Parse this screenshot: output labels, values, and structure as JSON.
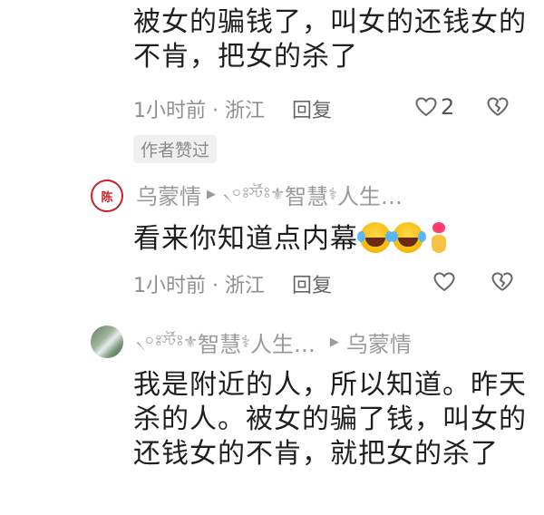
{
  "comment1": {
    "text": "被女的骗钱了，叫女的还钱女的不肯，把女的杀了",
    "time_location": "1小时前 · 浙江",
    "reply": "回复",
    "likes": "2",
    "author_badge": "作者赞过"
  },
  "reply1": {
    "avatar_char": "陈",
    "user": "乌蒙情",
    "reply_to_prefix": "৲০ঃৰ্স্টঃ",
    "reply_to_name": "智慧",
    "reply_to_suffix": "人生…",
    "text": "看来你知道点内幕",
    "time_location": "1小时前 · 浙江",
    "reply": "回复"
  },
  "reply2": {
    "user_prefix": "৲০ঃৰ্স্টঃ",
    "user_name": "智慧",
    "user_suffix": "人生…",
    "reply_to": "乌蒙情",
    "text": "我是附近的人，所以知道。昨天杀的人。被女的骗了钱，叫女的还钱女的不肯，就把女的杀了"
  },
  "icons": {
    "like": "heart-outline-icon",
    "dislike": "broken-heart-icon",
    "separator": "triangle-right-icon"
  }
}
